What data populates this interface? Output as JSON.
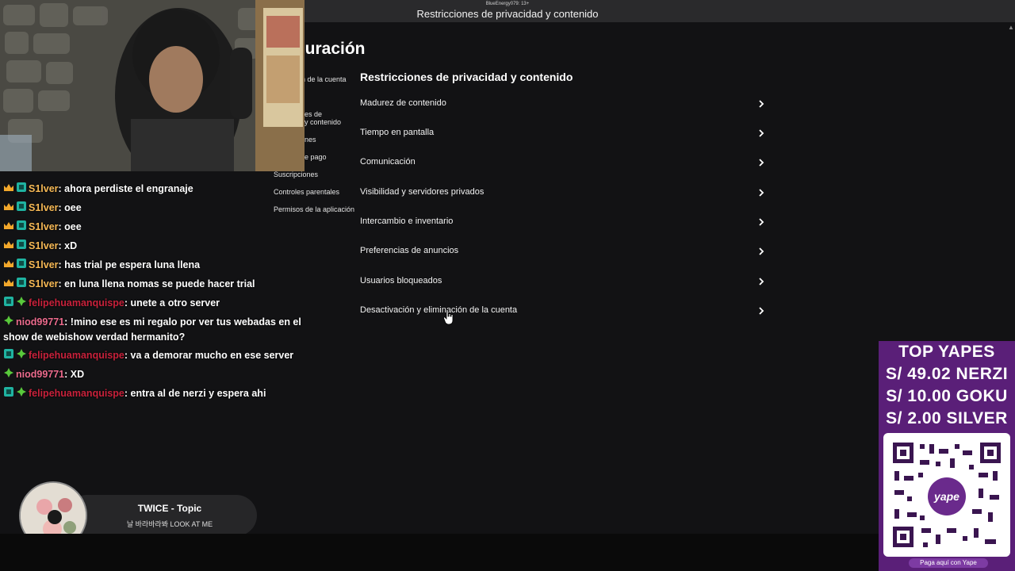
{
  "window": {
    "user_line": "BlueEnergy079: 13+",
    "title": "Restricciones de privacidad y contenido"
  },
  "page_heading": "iguración",
  "side_nav": [
    "n de la cuenta",
    "es de",
    "y contenido",
    "nes",
    "e pago",
    "Suscripciones",
    "Controles parentales",
    "Permisos de la aplicación"
  ],
  "section_title": "Restricciones de privacidad y contenido",
  "settings": [
    "Madurez de contenido",
    "Tiempo en pantalla",
    "Comunicación",
    "Visibilidad y servidores privados",
    "Intercambio e inventario",
    "Preferencias de anuncios",
    "Usuarios bloqueados",
    "Desactivación y eliminación de la cuenta"
  ],
  "chat": [
    {
      "user": "S1lver",
      "text": "ahora perdiste el engranaje"
    },
    {
      "user": "S1lver",
      "text": "oee"
    },
    {
      "user": "S1lver",
      "text": "oee"
    },
    {
      "user": "S1lver",
      "text": "xD"
    },
    {
      "user": "S1lver",
      "text": "has trial pe espera luna llena"
    },
    {
      "user": "S1lver",
      "text": "en luna llena nomas se puede hacer trial"
    },
    {
      "user": "felipehuamanquispe",
      "text": "unete a otro server"
    },
    {
      "user": "niod99771",
      "text": "!mino ese es mi regalo por ver tus webadas en el show de webishow verdad hermanito?"
    },
    {
      "user": "felipehuamanquispe",
      "text": "va a demorar mucho en ese server"
    },
    {
      "user": "niod99771",
      "text": "XD"
    },
    {
      "user": "felipehuamanquispe",
      "text": "entra al de nerzi y espera ahi"
    }
  ],
  "music": {
    "artist": "TWICE - Topic",
    "song": "날 바라바라봐 LOOK AT ME"
  },
  "donations": {
    "heading": "TOP YAPES",
    "rows": [
      "S/ 49.02 NERZI",
      "S/ 10.00 GOKU",
      "S/ 2.00 SILVER"
    ],
    "cta": "Paga aquí con Yape",
    "qr_logo": "yape"
  },
  "colors": {
    "accent_gold": "#f7b955",
    "accent_red": "#c8213b",
    "accent_pink": "#ec6b8d",
    "panel_purple": "#5a1f78"
  }
}
